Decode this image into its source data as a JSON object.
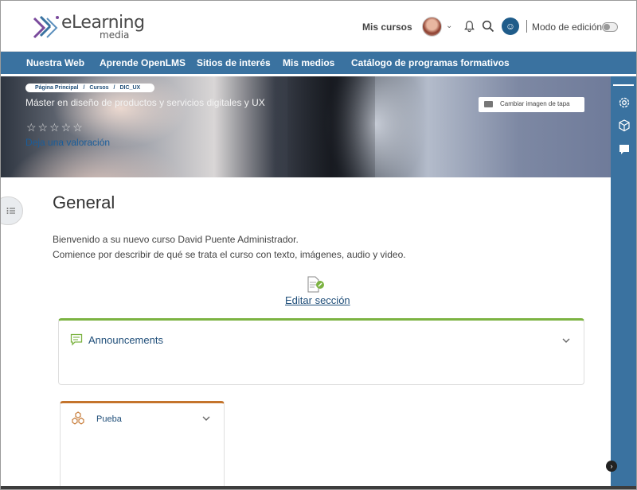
{
  "header": {
    "logo_text": "eLearning",
    "logo_sub": "media",
    "my_courses": "Mis cursos",
    "edit_mode": "Modo de edición",
    "icons": [
      "avatar",
      "bell-icon",
      "search-icon",
      "accessibility-icon"
    ]
  },
  "nav": {
    "items": [
      {
        "label": "Nuestra Web"
      },
      {
        "label": "Aprende OpenLMS"
      },
      {
        "label": "Sitios de interés"
      },
      {
        "label": "Mis medios"
      },
      {
        "label": "Catálogo de programas formativos"
      }
    ]
  },
  "banner": {
    "breadcrumb": [
      "Página Principal",
      "/",
      "Cursos",
      "/",
      "DIC_UX"
    ],
    "course_title": "Máster en diseño de productos y servicios digitales y UX",
    "stars": "☆☆☆☆☆",
    "rate_link": "Deja una valoración",
    "cover_button": "Cambiar imagen de tapa"
  },
  "main": {
    "section_title": "General",
    "welcome_line1": "Bienvenido a su nuevo curso David Puente Administrador.",
    "welcome_line2": "Comience por describir de qué se trata el curso con texto, imágenes, audio y video.",
    "edit_section": "Editar sección",
    "announcements": "Announcements",
    "pueba": "Pueba"
  },
  "colors": {
    "nav_blue": "#3a72a0",
    "link_blue": "#1f4e79",
    "announcement_accent": "#7cb342",
    "pueba_accent": "#c4742c"
  }
}
